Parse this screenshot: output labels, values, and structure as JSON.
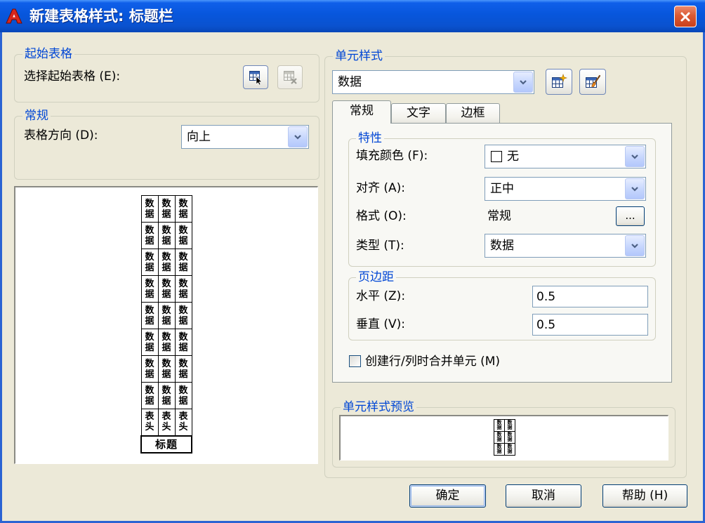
{
  "window": {
    "title": "新建表格样式: 标题栏"
  },
  "starting_table": {
    "group_label": "起始表格",
    "select_label": "选择起始表格 (E):"
  },
  "general": {
    "group_label": "常规",
    "direction_label": "表格方向 (D):",
    "direction_value": "向上"
  },
  "table_preview": {
    "rows": [
      [
        "数据",
        "数据",
        "数据"
      ],
      [
        "数据",
        "数据",
        "数据"
      ],
      [
        "数据",
        "数据",
        "数据"
      ],
      [
        "数据",
        "数据",
        "数据"
      ],
      [
        "数据",
        "数据",
        "数据"
      ],
      [
        "数据",
        "数据",
        "数据"
      ],
      [
        "数据",
        "数据",
        "数据"
      ],
      [
        "数据",
        "数据",
        "数据"
      ],
      [
        "表头",
        "表头",
        "表头"
      ]
    ],
    "title": "标题"
  },
  "cell_styles": {
    "group_label": "单元样式",
    "selected": "数据",
    "tabs": [
      "常规",
      "文字",
      "边框"
    ],
    "active_tab": 0
  },
  "properties": {
    "group_label": "特性",
    "fill_color_label": "填充颜色 (F):",
    "fill_color_value": "无",
    "alignment_label": "对齐 (A):",
    "alignment_value": "正中",
    "format_label": "格式 (O):",
    "format_value": "常规",
    "format_button": "...",
    "type_label": "类型 (T):",
    "type_value": "数据"
  },
  "margins": {
    "group_label": "页边距",
    "horizontal_label": "水平 (Z):",
    "horizontal_value": "0.5",
    "vertical_label": "垂直 (V):",
    "vertical_value": "0.5"
  },
  "merge": {
    "label": "创建行/列时合并单元 (M)",
    "checked": false
  },
  "cell_preview": {
    "group_label": "单元样式预览",
    "rows": [
      [
        "数据",
        "数据"
      ],
      [
        "数据",
        "数据"
      ],
      [
        "数据",
        "数据"
      ]
    ]
  },
  "buttons": {
    "ok": "确定",
    "cancel": "取消",
    "help": "帮助 (H)"
  },
  "colors": {
    "legend_text": "#0046d5",
    "fill_swatch": "#ffffff"
  }
}
